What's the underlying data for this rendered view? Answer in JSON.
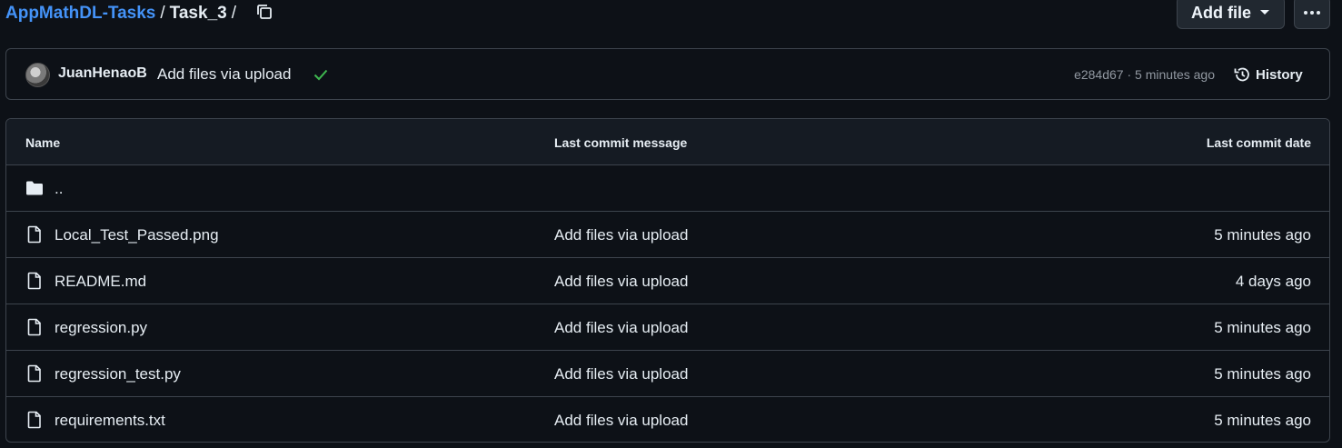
{
  "breadcrumb": {
    "repo": "AppMathDL-Tasks",
    "separator": "/",
    "current": "Task_3",
    "trailing_separator": "/"
  },
  "toolbar": {
    "add_file_label": "Add file",
    "more_icon": "kebab-horizontal-icon"
  },
  "commit": {
    "author": "JuanHenaoB",
    "message": "Add files via upload",
    "status": "success",
    "sha": "e284d67",
    "separator": "·",
    "time": "5 minutes ago",
    "history_label": "History"
  },
  "table": {
    "headers": {
      "name": "Name",
      "message": "Last commit message",
      "date": "Last commit date"
    },
    "parent_row": {
      "name": "..",
      "icon": "folder-icon"
    },
    "rows": [
      {
        "name": "Local_Test_Passed.png",
        "message": "Add files via upload",
        "date": "5 minutes ago",
        "icon": "file-icon"
      },
      {
        "name": "README.md",
        "message": "Add files via upload",
        "date": "4 days ago",
        "icon": "file-icon"
      },
      {
        "name": "regression.py",
        "message": "Add files via upload",
        "date": "5 minutes ago",
        "icon": "file-icon"
      },
      {
        "name": "regression_test.py",
        "message": "Add files via upload",
        "date": "5 minutes ago",
        "icon": "file-icon"
      },
      {
        "name": "requirements.txt",
        "message": "Add files via upload",
        "date": "5 minutes ago",
        "icon": "file-icon"
      }
    ]
  },
  "colors": {
    "background": "#0d1117",
    "link": "#4493f8",
    "border": "#3d444d",
    "success": "#3fb950"
  }
}
